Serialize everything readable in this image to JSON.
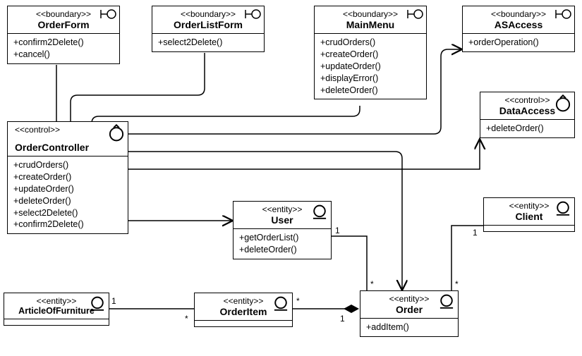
{
  "classes": {
    "orderForm": {
      "stereotype": "<<boundary>>",
      "name": "OrderForm",
      "ops": [
        "+confirm2Delete()",
        "+cancel()"
      ]
    },
    "orderListForm": {
      "stereotype": "<<boundary>>",
      "name": "OrderListForm",
      "ops": [
        "+select2Delete()"
      ]
    },
    "mainMenu": {
      "stereotype": "<<boundary>>",
      "name": "MainMenu",
      "ops": [
        "+crudOrders()",
        "+createOrder()",
        "+updateOrder()",
        "+displayError()",
        "+deleteOrder()"
      ]
    },
    "asAccess": {
      "stereotype": "<<boundary>>",
      "name": "ASAccess",
      "ops": [
        "+orderOperation()"
      ]
    },
    "dataAccess": {
      "stereotype": "<<control>>",
      "name": "DataAccess",
      "ops": [
        "+deleteOrder()"
      ]
    },
    "orderController": {
      "stereotype": "<<control>>",
      "name": "OrderController",
      "ops": [
        "+crudOrders()",
        "+createOrder()",
        "+updateOrder()",
        "+deleteOrder()",
        "+select2Delete()",
        "+confirm2Delete()"
      ]
    },
    "user": {
      "stereotype": "<<entity>>",
      "name": "User",
      "ops": [
        "+getOrderList()",
        "+deleteOrder()"
      ]
    },
    "client": {
      "stereotype": "<<entity>>",
      "name": "Client",
      "ops": []
    },
    "articleOfFurniture": {
      "stereotype": "<<entity>>",
      "name": "ArticleOfFurniture",
      "ops": []
    },
    "orderItem": {
      "stereotype": "<<entity>>",
      "name": "OrderItem",
      "ops": []
    },
    "order": {
      "stereotype": "<<entity>>",
      "name": "Order",
      "ops": [
        "+addItem()"
      ]
    }
  },
  "mult": {
    "aof_one": "1",
    "orderItem_starL": "*",
    "orderItem_starR": "*",
    "order_one": "1",
    "user_one": "1",
    "order_starUser": "*",
    "client_one": "1",
    "order_starClient": "*"
  },
  "chart_data": {
    "type": "diagram",
    "notation": "UML Class Diagram",
    "classes": [
      {
        "name": "OrderForm",
        "stereotype": "boundary",
        "operations": [
          "confirm2Delete()",
          "cancel()"
        ]
      },
      {
        "name": "OrderListForm",
        "stereotype": "boundary",
        "operations": [
          "select2Delete()"
        ]
      },
      {
        "name": "MainMenu",
        "stereotype": "boundary",
        "operations": [
          "crudOrders()",
          "createOrder()",
          "updateOrder()",
          "displayError()",
          "deleteOrder()"
        ]
      },
      {
        "name": "ASAccess",
        "stereotype": "boundary",
        "operations": [
          "orderOperation()"
        ]
      },
      {
        "name": "OrderController",
        "stereotype": "control",
        "operations": [
          "crudOrders()",
          "createOrder()",
          "updateOrder()",
          "deleteOrder()",
          "select2Delete()",
          "confirm2Delete()"
        ]
      },
      {
        "name": "DataAccess",
        "stereotype": "control",
        "operations": [
          "deleteOrder()"
        ]
      },
      {
        "name": "User",
        "stereotype": "entity",
        "operations": [
          "getOrderList()",
          "deleteOrder()"
        ]
      },
      {
        "name": "Client",
        "stereotype": "entity",
        "operations": []
      },
      {
        "name": "ArticleOfFurniture",
        "stereotype": "entity",
        "operations": []
      },
      {
        "name": "OrderItem",
        "stereotype": "entity",
        "operations": []
      },
      {
        "name": "Order",
        "stereotype": "entity",
        "operations": [
          "addItem()"
        ]
      }
    ],
    "relationships": [
      {
        "from": "OrderController",
        "to": "OrderForm",
        "type": "association",
        "navigable": false
      },
      {
        "from": "OrderController",
        "to": "OrderListForm",
        "type": "association",
        "navigable": false
      },
      {
        "from": "OrderController",
        "to": "MainMenu",
        "type": "association",
        "navigable": false
      },
      {
        "from": "OrderController",
        "to": "ASAccess",
        "type": "association",
        "navigable": "to"
      },
      {
        "from": "OrderController",
        "to": "DataAccess",
        "type": "association",
        "navigable": "to"
      },
      {
        "from": "OrderController",
        "to": "User",
        "type": "association",
        "navigable": "to"
      },
      {
        "from": "OrderController",
        "to": "Order",
        "type": "association",
        "navigable": "to"
      },
      {
        "from": "User",
        "to": "Order",
        "type": "association",
        "mult": {
          "User": "1",
          "Order": "*"
        }
      },
      {
        "from": "Client",
        "to": "Order",
        "type": "association",
        "mult": {
          "Client": "1",
          "Order": "*"
        }
      },
      {
        "from": "Order",
        "to": "OrderItem",
        "type": "composition",
        "whole": "Order",
        "mult": {
          "Order": "1",
          "OrderItem": "*"
        }
      },
      {
        "from": "ArticleOfFurniture",
        "to": "OrderItem",
        "type": "association",
        "mult": {
          "ArticleOfFurniture": "1",
          "OrderItem": "*"
        }
      }
    ]
  }
}
